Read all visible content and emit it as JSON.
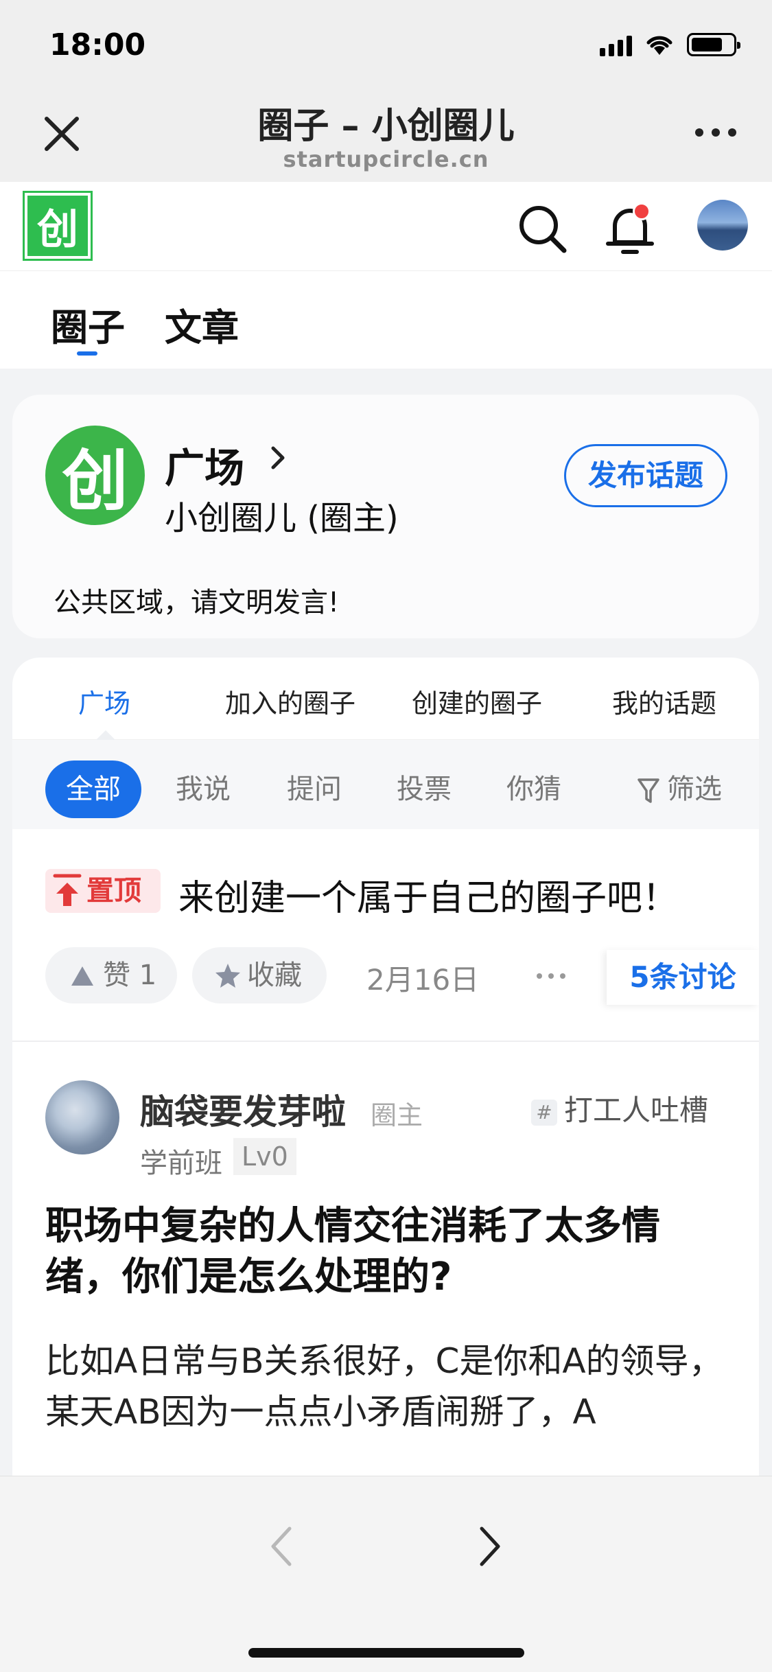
{
  "status_bar": {
    "time": "18:00",
    "battery_level": 0.75
  },
  "browser": {
    "title": "圈子 – 小创圈儿",
    "url": "startupcircle.cn"
  },
  "header": {
    "logo_text": "创",
    "notification_count_indicator": true
  },
  "top_tabs": [
    {
      "label": "圈子",
      "active": true
    },
    {
      "label": "文章",
      "active": false
    }
  ],
  "circle": {
    "logo_text": "创",
    "name": "广场",
    "owner": "小创圈儿 (圈主)",
    "publish_label": "发布话题",
    "description": "公共区域，请文明发言!"
  },
  "sub_tabs": [
    {
      "label": "广场",
      "active": true
    },
    {
      "label": "加入的圈子",
      "active": false
    },
    {
      "label": "创建的圈子",
      "active": false
    },
    {
      "label": "我的话题",
      "active": false
    }
  ],
  "filters": [
    {
      "label": "全部",
      "active": true
    },
    {
      "label": "我说",
      "active": false
    },
    {
      "label": "提问",
      "active": false
    },
    {
      "label": "投票",
      "active": false
    },
    {
      "label": "你猜",
      "active": false
    }
  ],
  "filter_button_label": "筛选",
  "pinned_post": {
    "badge": "置顶",
    "title": "来创建一个属于自己的圈子吧！",
    "like_label": "赞 1",
    "favorite_label": "收藏",
    "date": "2月16日",
    "discussion_label": "5条讨论"
  },
  "post": {
    "author": "脑袋要发芽啦",
    "owner_tag": "圈主",
    "topic_hash": "#",
    "topic": "打工人吐槽",
    "level_name": "学前班",
    "level": "Lv0",
    "title": "职场中复杂的人情交往消耗了太多情绪，你们是怎么处理的?",
    "body": "比如A日常与B关系很好，C是你和A的领导，某天AB因为一点点小矛盾闹掰了，A"
  },
  "colors": {
    "accent": "#1a6fe8",
    "brand_green": "#3cb54a",
    "pin_red": "#e23a3a"
  }
}
